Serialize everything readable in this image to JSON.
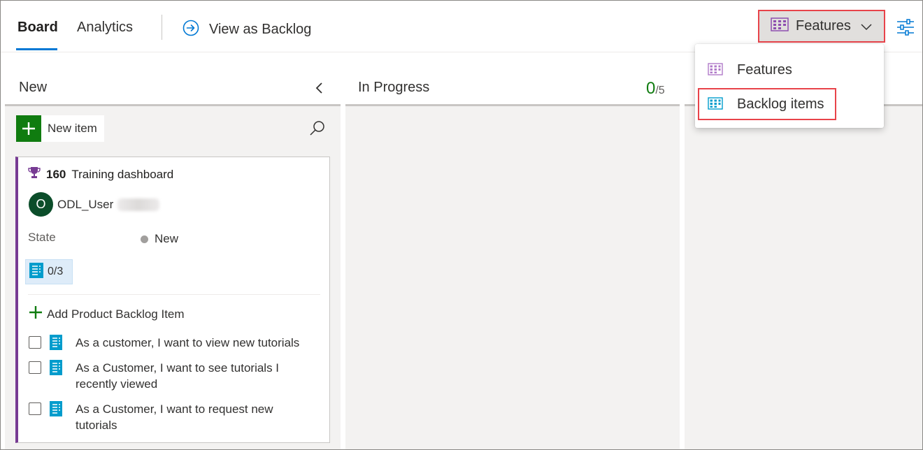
{
  "header": {
    "tabs": [
      {
        "label": "Board",
        "active": true
      },
      {
        "label": "Analytics",
        "active": false
      }
    ],
    "view_backlog_label": "View as Backlog",
    "backlog_level_button": "Features",
    "icons": {
      "view_backlog": "arrow-circle-right-icon",
      "backlog_level": "grid-board-icon",
      "chevron": "chevron-down-icon",
      "settings": "settings-sliders-icon"
    }
  },
  "dropdown": {
    "items": [
      {
        "label": "Features",
        "icon_color": "#b07ac9"
      },
      {
        "label": "Backlog items",
        "icon_color": "#009ccc",
        "highlighted": true
      }
    ]
  },
  "columns": [
    {
      "name": "New",
      "collapse_icon": "chevron-left-icon"
    },
    {
      "name": "In Progress",
      "wip_current": "0",
      "wip_limit": "/5"
    },
    {
      "name": ""
    }
  ],
  "new_column": {
    "new_item_label": "New item",
    "search_icon": "search-icon"
  },
  "card": {
    "id": "160",
    "title": "Training dashboard",
    "type_icon": "trophy-icon",
    "type_color": "#773b93",
    "assignee_initial": "O",
    "assignee_name": "ODL_User",
    "state_label": "State",
    "state_value": "New",
    "children_progress": "0/3",
    "add_child_label": "Add Product Backlog Item",
    "children": [
      {
        "text": "As a customer, I want to view new tutorials"
      },
      {
        "text": "As a Customer, I want to see tutorials I recently viewed"
      },
      {
        "text": "As a Customer, I want to request new tutorials"
      }
    ]
  },
  "colors": {
    "accent": "#0078d4",
    "green": "#107c10",
    "highlight_red": "#e8434a",
    "pbi_blue": "#009ccc"
  }
}
